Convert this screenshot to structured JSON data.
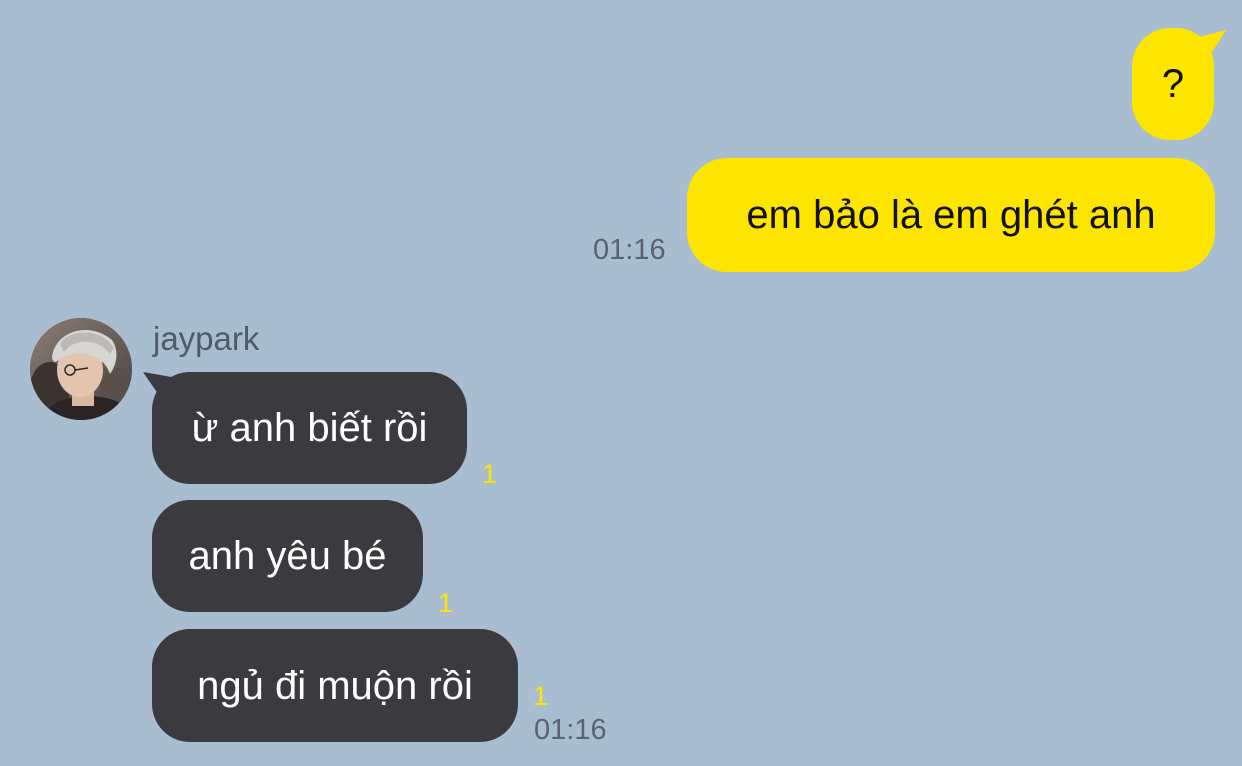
{
  "chat": {
    "outgoing": [
      {
        "text": "?"
      },
      {
        "text": "em bảo là em ghét anh",
        "time": "01:16"
      }
    ],
    "contact": {
      "name": "jaypark",
      "avatar": "profile-photo"
    },
    "incoming": [
      {
        "text": "ừ anh biết rồi",
        "unread": "1"
      },
      {
        "text": "anh yêu bé",
        "unread": "1"
      },
      {
        "text": "ngủ đi muộn rồi",
        "unread": "1",
        "time": "01:16"
      }
    ]
  },
  "colors": {
    "background": "#a9bdd0",
    "outgoing_bubble": "#fee500",
    "incoming_bubble": "#3b3a3e",
    "unread_count": "#fee500"
  }
}
